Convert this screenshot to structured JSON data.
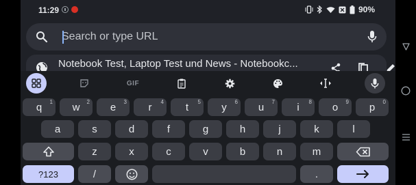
{
  "status_bar": {
    "time": "11:29",
    "battery": "90%",
    "icons": [
      "alert-icon",
      "app-notification-icon",
      "vibrate-icon",
      "bluetooth-icon",
      "wifi-icon",
      "nfc-icon",
      "battery-icon"
    ]
  },
  "url_bar": {
    "placeholder": "Search or type URL",
    "value": ""
  },
  "suggestion": {
    "text": "Notebook Test, Laptop Test und News - Notebookc..."
  },
  "keyboard": {
    "toolbar": {
      "gif_label": "GIF",
      "items": [
        "apps-grid-icon",
        "sticker-icon",
        "gif",
        "clipboard-icon",
        "settings-icon",
        "palette-icon",
        "cursor-move-icon",
        "mic-icon"
      ]
    },
    "row1": [
      {
        "label": "q",
        "hint": "1"
      },
      {
        "label": "w",
        "hint": "2"
      },
      {
        "label": "e",
        "hint": "3"
      },
      {
        "label": "r",
        "hint": "4"
      },
      {
        "label": "t",
        "hint": "5"
      },
      {
        "label": "y",
        "hint": "6"
      },
      {
        "label": "u",
        "hint": "7"
      },
      {
        "label": "i",
        "hint": "8"
      },
      {
        "label": "o",
        "hint": "9"
      },
      {
        "label": "p",
        "hint": "0"
      }
    ],
    "row2": [
      "a",
      "s",
      "d",
      "f",
      "g",
      "h",
      "j",
      "k",
      "l"
    ],
    "row3": [
      "z",
      "x",
      "c",
      "v",
      "b",
      "n",
      "m"
    ],
    "row4": {
      "symbols": "?123",
      "slash": "/",
      "period": "."
    }
  },
  "colors": {
    "background": "#1f2127",
    "accent": "#c7cdfb",
    "key": "#3b3d44"
  }
}
